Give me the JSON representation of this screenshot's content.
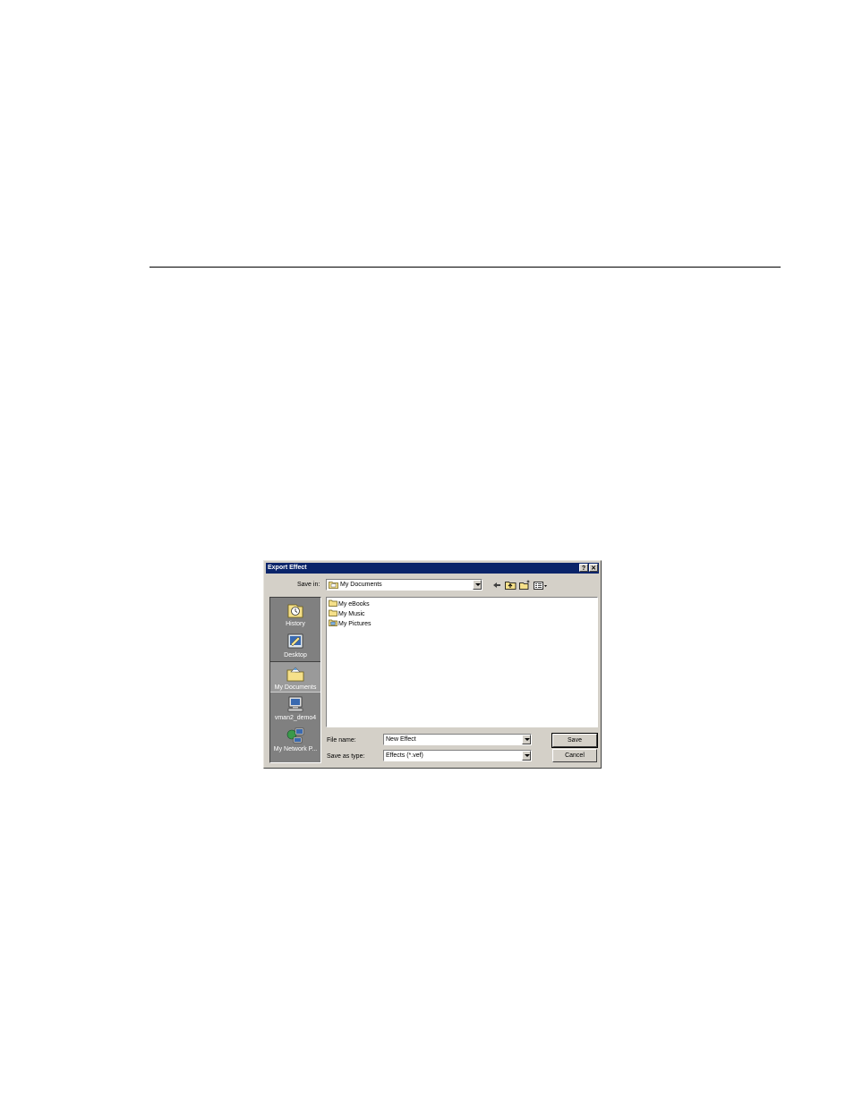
{
  "dialog": {
    "title": "Export Effect",
    "help_label": "?",
    "close_label": "✕"
  },
  "save_in": {
    "label": "Save in:",
    "value": "My Documents"
  },
  "places": [
    {
      "label": "History",
      "icon": "history-icon"
    },
    {
      "label": "Desktop",
      "icon": "desktop-icon"
    },
    {
      "label": "My Documents",
      "icon": "my-documents-icon",
      "selected": true
    },
    {
      "label": "vman2_demo4",
      "icon": "computer-icon"
    },
    {
      "label": "My Network P...",
      "icon": "network-places-icon"
    }
  ],
  "files": [
    {
      "name": "My eBooks",
      "icon": "folder-icon"
    },
    {
      "name": "My Music",
      "icon": "folder-icon"
    },
    {
      "name": "My Pictures",
      "icon": "pictures-folder-icon"
    }
  ],
  "file_name": {
    "label": "File name:",
    "value": "New Effect"
  },
  "save_as_type": {
    "label": "Save as type:",
    "value": "Effects (*.vef)"
  },
  "buttons": {
    "save": "Save",
    "cancel": "Cancel"
  },
  "toolbar": {
    "back_icon": "back-arrow-icon",
    "up_icon": "up-folder-icon",
    "new_folder_icon": "new-folder-icon",
    "views_icon": "views-menu-icon"
  },
  "colors": {
    "title_bar": "#0a246a",
    "dialog_face": "#d4d0c8",
    "places_bar": "#808080"
  }
}
